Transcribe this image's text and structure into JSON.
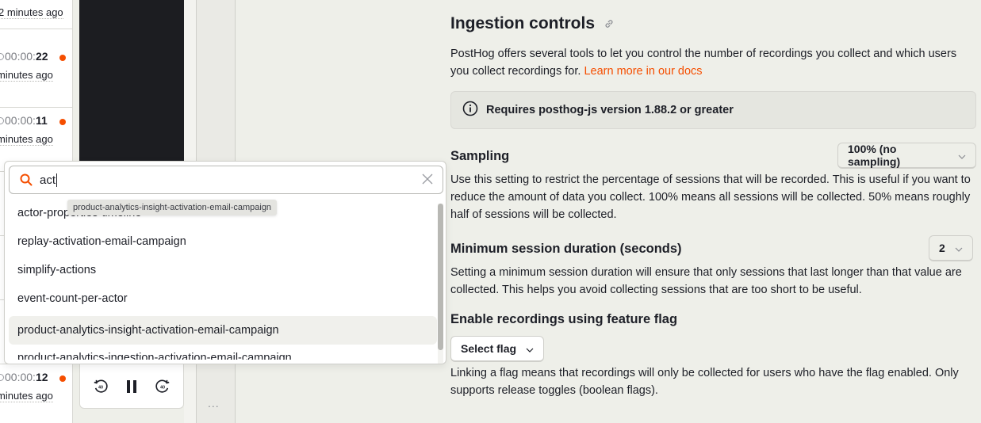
{
  "recordings": [
    {
      "duration_prefix": "",
      "duration_bold": "",
      "ago": "2 minutes ago"
    },
    {
      "duration_prefix": "00:00:",
      "duration_bold": "22",
      "ago": "minutes ago"
    },
    {
      "duration_prefix": "00:00:",
      "duration_bold": "11",
      "ago": "minutes ago"
    },
    {
      "duration_prefix": "00:00:",
      "duration_bold": "12",
      "ago": "minutes ago"
    }
  ],
  "player": {
    "rewind_label": "40",
    "forward_label": "40",
    "more_label": "..."
  },
  "flag_picker": {
    "search_value": "act",
    "tooltip": "product-analytics-insight-activation-email-campaign",
    "options": [
      "actor-properties-timeline",
      "replay-activation-email-campaign",
      "simplify-actions",
      "event-count-per-actor",
      "product-analytics-insight-activation-email-campaign",
      "product-analytics-ingestion-activation-email-campaign"
    ],
    "active_index": 4
  },
  "settings": {
    "title": "Ingestion controls",
    "intro": "PostHog offers several tools to let you control the number of recordings you collect and which users you collect recordings for. ",
    "intro_link": "Learn more in our docs",
    "banner": "Requires posthog-js version 1.88.2 or greater",
    "sampling": {
      "title": "Sampling",
      "value": "100% (no sampling)",
      "description": "Use this setting to restrict the percentage of sessions that will be recorded. This is useful if you want to reduce the amount of data you collect. 100% means all sessions will be collected. 50% means roughly half of sessions will be collected."
    },
    "min_duration": {
      "title": "Minimum session duration (seconds)",
      "value": "2",
      "description": "Setting a minimum session duration will ensure that only sessions that last longer than that value are collected. This helps you avoid collecting sessions that are too short to be useful."
    },
    "feature_flag": {
      "title": "Enable recordings using feature flag",
      "button": "Select flag",
      "description": "Linking a flag means that recordings will only be collected for users who have the flag enabled. Only supports release toggles (boolean flags)."
    }
  },
  "colors": {
    "accent": "#f54e00",
    "background": "#eeefe9",
    "player_bg": "#1c1d21"
  }
}
